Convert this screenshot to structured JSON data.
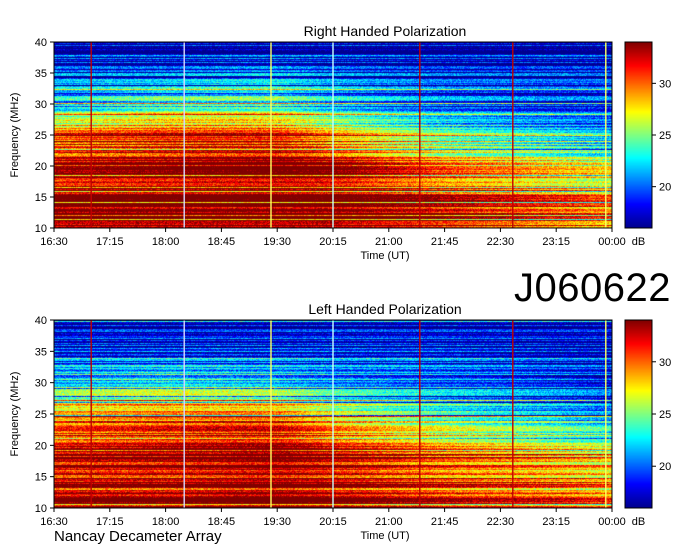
{
  "observation_id": "J060622",
  "credit": "Nancay Decameter Array",
  "colormap": [
    "#00008f",
    "#0000ff",
    "#0080ff",
    "#00ffff",
    "#80ff80",
    "#ffff00",
    "#ff8000",
    "#ff0000",
    "#800000"
  ],
  "chart_data": [
    {
      "type": "heatmap",
      "title": "Right Handed Polarization",
      "xlabel": "Time (UT)",
      "ylabel": "Frequency (MHz)",
      "x_ticks": [
        "16:30",
        "17:15",
        "18:00",
        "18:45",
        "19:30",
        "20:15",
        "21:00",
        "21:45",
        "22:30",
        "23:15",
        "00:00"
      ],
      "y_ticks": [
        10,
        15,
        20,
        25,
        30,
        35,
        40
      ],
      "ylim": [
        10,
        40
      ],
      "colorbar": {
        "ticks": [
          20,
          25,
          30
        ],
        "unit": "dB",
        "range": [
          16,
          34
        ]
      },
      "annotation_lines": [
        {
          "time": "17:00",
          "color": "#c00000"
        },
        {
          "time": "18:15",
          "color": "#d8d8ff"
        },
        {
          "time": "19:25",
          "color": "#ffff60"
        },
        {
          "time": "20:15",
          "color": "#c8ffff"
        },
        {
          "time": "21:25",
          "color": "#c00000"
        },
        {
          "time": "22:40",
          "color": "#c00000"
        },
        {
          "time": "23:55",
          "color": "#ffff60"
        }
      ],
      "intensity_db": [
        {
          "time": "16:30",
          "f15": 34,
          "f20": 32,
          "f25": 30,
          "f30": 22,
          "f35": 19,
          "f40": 17
        },
        {
          "time": "18:00",
          "f15": 34,
          "f20": 33,
          "f25": 31,
          "f30": 24,
          "f35": 19,
          "f40": 17
        },
        {
          "time": "19:30",
          "f15": 34,
          "f20": 34,
          "f25": 31,
          "f30": 24,
          "f35": 20,
          "f40": 17
        },
        {
          "time": "20:15",
          "f15": 34,
          "f20": 33,
          "f25": 28,
          "f30": 22,
          "f35": 19,
          "f40": 17
        },
        {
          "time": "21:45",
          "f15": 32,
          "f20": 29,
          "f25": 24,
          "f30": 20,
          "f35": 18,
          "f40": 17
        },
        {
          "time": "23:15",
          "f15": 30,
          "f20": 27,
          "f25": 22,
          "f30": 19,
          "f35": 18,
          "f40": 17
        },
        {
          "time": "00:00",
          "f15": 29,
          "f20": 26,
          "f25": 21,
          "f30": 19,
          "f35": 18,
          "f40": 17
        }
      ]
    },
    {
      "type": "heatmap",
      "title": "Left Handed Polarization",
      "xlabel": "Time (UT)",
      "ylabel": "Frequency (MHz)",
      "x_ticks": [
        "16:30",
        "17:15",
        "18:00",
        "18:45",
        "19:30",
        "20:15",
        "21:00",
        "21:45",
        "22:30",
        "23:15",
        "00:00"
      ],
      "y_ticks": [
        10,
        15,
        20,
        25,
        30,
        35,
        40
      ],
      "ylim": [
        10,
        40
      ],
      "colorbar": {
        "ticks": [
          20,
          25,
          30
        ],
        "unit": "dB",
        "range": [
          16,
          34
        ]
      },
      "annotation_lines": [
        {
          "time": "17:00",
          "color": "#c00000"
        },
        {
          "time": "18:15",
          "color": "#d8d8ff"
        },
        {
          "time": "19:25",
          "color": "#ffff60"
        },
        {
          "time": "20:15",
          "color": "#c8ffff"
        },
        {
          "time": "21:25",
          "color": "#c00000"
        },
        {
          "time": "22:40",
          "color": "#c00000"
        },
        {
          "time": "23:55",
          "color": "#ffff60"
        }
      ],
      "intensity_db": [
        {
          "time": "16:30",
          "f15": 33,
          "f20": 31,
          "f25": 29,
          "f30": 23,
          "f35": 19,
          "f40": 17
        },
        {
          "time": "18:00",
          "f15": 33,
          "f20": 32,
          "f25": 30,
          "f30": 24,
          "f35": 19,
          "f40": 17
        },
        {
          "time": "19:30",
          "f15": 34,
          "f20": 33,
          "f25": 30,
          "f30": 23,
          "f35": 19,
          "f40": 17
        },
        {
          "time": "20:15",
          "f15": 33,
          "f20": 31,
          "f25": 27,
          "f30": 22,
          "f35": 19,
          "f40": 17
        },
        {
          "time": "21:45",
          "f15": 31,
          "f20": 28,
          "f25": 24,
          "f30": 21,
          "f35": 19,
          "f40": 17
        },
        {
          "time": "23:15",
          "f15": 30,
          "f20": 26,
          "f25": 22,
          "f30": 20,
          "f35": 18,
          "f40": 17
        },
        {
          "time": "00:00",
          "f15": 29,
          "f20": 25,
          "f25": 21,
          "f30": 19,
          "f35": 18,
          "f40": 17
        }
      ]
    }
  ]
}
